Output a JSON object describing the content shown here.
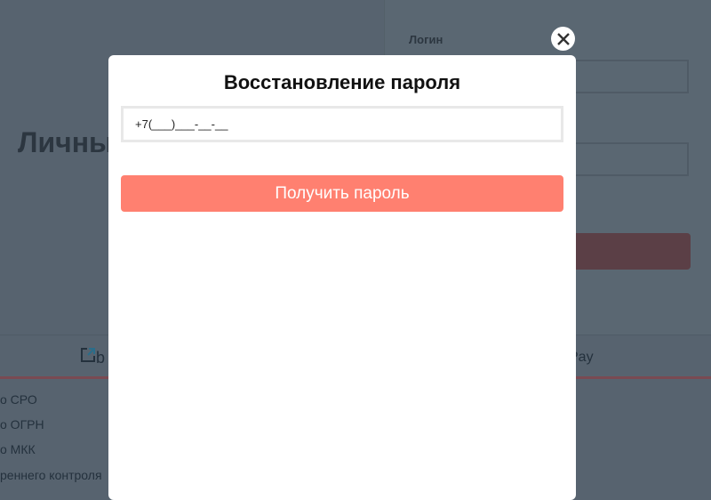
{
  "background": {
    "page_title_partial": "Личны",
    "login_label": "Логин",
    "external_link_partial": "b",
    "pay_partial": "Pay",
    "footer_links": [
      "о СРО",
      "о ОГРН",
      "о МКК",
      "реннего контроля"
    ]
  },
  "modal": {
    "title": "Восстановление пароля",
    "phone_value": "+7(___)___-__-__",
    "submit_label": "Получить пароль"
  },
  "colors": {
    "accent": "#ff8070",
    "overlay": "#57636f"
  }
}
